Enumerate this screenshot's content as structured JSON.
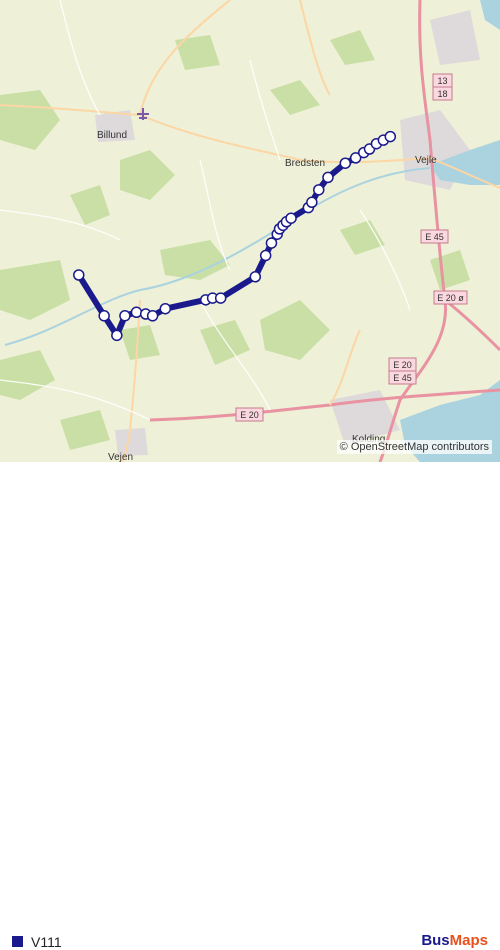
{
  "map": {
    "places": [
      {
        "name": "Billund",
        "lon": 9.114,
        "lat": 55.731
      },
      {
        "name": "Bredsten",
        "lon": 9.37,
        "lat": 55.705
      },
      {
        "name": "Vejle",
        "lon": 9.535,
        "lat": 55.709
      },
      {
        "name": "Kolding",
        "lon": 9.47,
        "lat": 55.49
      },
      {
        "name": "Vejen",
        "lon": 9.14,
        "lat": 55.48
      }
    ],
    "road_labels": [
      "13",
      "18",
      "E 45",
      "E 20 ø",
      "E 20",
      "E 45",
      "E 20"
    ],
    "colors": {
      "land": "#eef0d7",
      "forest": "#c9dfa6",
      "water": "#aad3df",
      "motorway": "#e892a2",
      "primary": "#fcd6a4",
      "route": "#1a1a8c"
    },
    "airport_icon": "airplane-icon"
  },
  "route": {
    "name": "V111",
    "color": "#1a1a8c",
    "stops": [
      [
        9.07,
        55.625
      ],
      [
        9.092,
        55.602
      ],
      [
        9.103,
        55.591
      ],
      [
        9.11,
        55.602
      ],
      [
        9.12,
        55.604
      ],
      [
        9.128,
        55.603
      ],
      [
        9.134,
        55.602
      ],
      [
        9.145,
        55.606
      ],
      [
        9.18,
        55.611
      ],
      [
        9.186,
        55.612
      ],
      [
        9.193,
        55.612
      ],
      [
        9.223,
        55.624
      ],
      [
        9.232,
        55.636
      ],
      [
        9.237,
        55.643
      ],
      [
        9.242,
        55.648
      ],
      [
        9.244,
        55.651
      ],
      [
        9.247,
        55.653
      ],
      [
        9.25,
        55.655
      ],
      [
        9.254,
        55.657
      ],
      [
        9.269,
        55.663
      ],
      [
        9.272,
        55.666
      ],
      [
        9.278,
        55.673
      ],
      [
        9.286,
        55.68
      ],
      [
        9.301,
        55.688
      ],
      [
        9.31,
        55.691
      ],
      [
        9.317,
        55.694
      ],
      [
        9.322,
        55.696
      ],
      [
        9.328,
        55.699
      ],
      [
        9.334,
        55.701
      ],
      [
        9.34,
        55.703
      ]
    ]
  },
  "attribution": "© OpenStreetMap contributors",
  "legend": {
    "label": "V111"
  },
  "brand": {
    "part1": "Bus",
    "part2": "Maps"
  }
}
